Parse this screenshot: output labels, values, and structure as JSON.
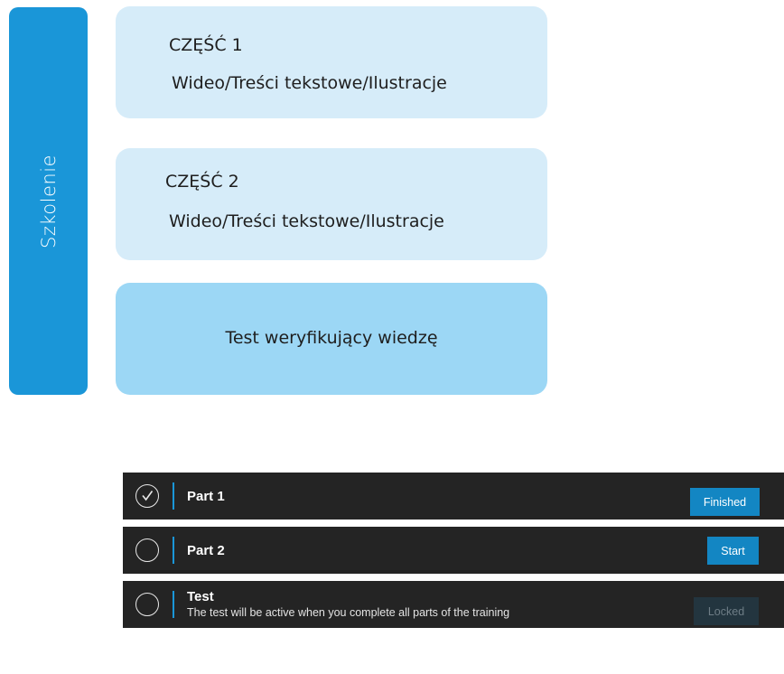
{
  "sidebar": {
    "label": "Szkolenie"
  },
  "cards": [
    {
      "title": "CZĘŚĆ 1",
      "subtitle": "Wideo/Treści tekstowe/Ilustracje"
    },
    {
      "title": "CZĘŚĆ 2",
      "subtitle": "Wideo/Treści tekstowe/Ilustracje"
    },
    {
      "title": "Test weryfikujący wiedzę"
    }
  ],
  "rows": [
    {
      "title": "Part 1",
      "status": "Finished",
      "completed": true,
      "icon": "check-circle-icon"
    },
    {
      "title": "Part 2",
      "status": "Start",
      "completed": false,
      "icon": "empty-circle-icon"
    },
    {
      "title": "Test",
      "description": "The test will be active when you complete all parts of the training",
      "status": "Locked",
      "completed": false,
      "icon": "empty-circle-icon"
    }
  ],
  "colors": {
    "accent": "#1a96d8",
    "card_light": "#d6ecf9",
    "card_medium": "#9cd7f5",
    "row_bg": "#242424",
    "button_active": "#1386c3",
    "button_locked": "#23353f"
  }
}
